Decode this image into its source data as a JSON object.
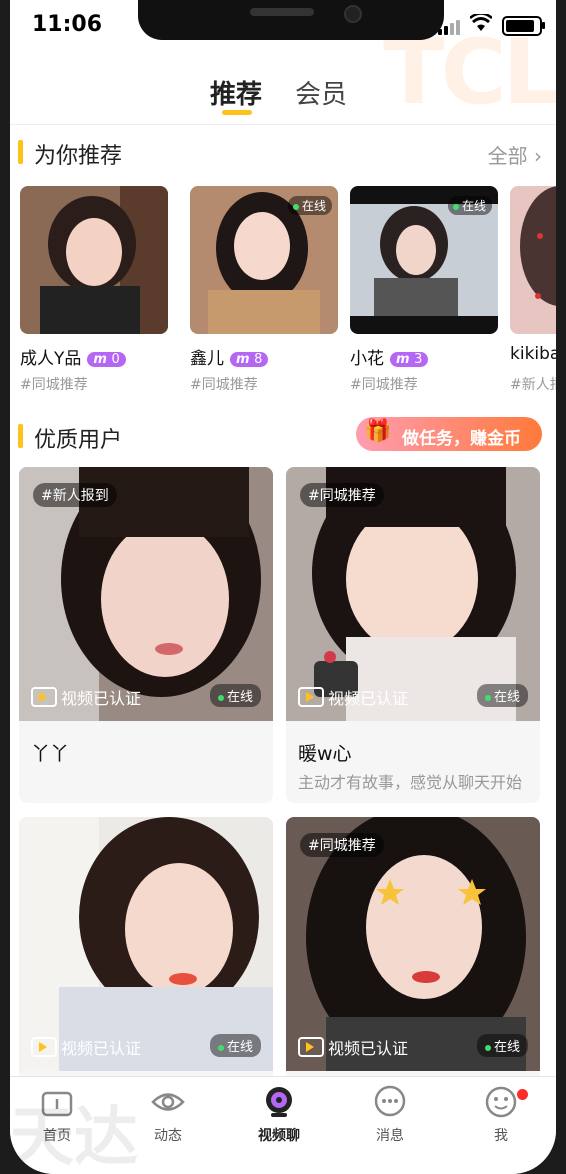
{
  "status": {
    "time": "11:06"
  },
  "tabs": [
    {
      "label": "推荐",
      "active": true
    },
    {
      "label": "会员",
      "active": false
    }
  ],
  "watermark": "TCL",
  "watermark2": "天达",
  "recommend": {
    "title": "为你推荐",
    "all_label": "全部",
    "items": [
      {
        "name": "成人Y品",
        "level": "0",
        "tag": "#同城推荐",
        "online": ""
      },
      {
        "name": "鑫儿",
        "level": "8",
        "tag": "#同城推荐",
        "online": "在线"
      },
      {
        "name": "小花",
        "level": "3",
        "tag": "#同城推荐",
        "online": "在线"
      },
      {
        "name": "kikiba",
        "level": "",
        "tag": "#新人报",
        "online": ""
      }
    ]
  },
  "quality": {
    "title": "优质用户",
    "task_button": "做任务，赚金币",
    "cards": [
      {
        "chip": "#新人报到",
        "verified": "视频已认证",
        "online": "在线",
        "name": "丫丫",
        "desc": ""
      },
      {
        "chip": "#同城推荐",
        "verified": "视频已认证",
        "online": "在线",
        "name": "暖w心",
        "desc": "主动才有故事，感觉从聊天开始"
      },
      {
        "chip": "",
        "verified": "视频已认证",
        "online": "在线",
        "name": "",
        "desc": ""
      },
      {
        "chip": "#同城推荐",
        "verified": "视频已认证",
        "online": "在线",
        "name": "",
        "desc": ""
      }
    ]
  },
  "nav": [
    {
      "label": "首页",
      "icon": "home-icon"
    },
    {
      "label": "动态",
      "icon": "eye-icon"
    },
    {
      "label": "视频聊",
      "icon": "video-chat-icon"
    },
    {
      "label": "消息",
      "icon": "message-icon"
    },
    {
      "label": "我",
      "icon": "smile-icon"
    }
  ],
  "colors": {
    "accent": "#ffc21a",
    "badge": "#b566f5",
    "online": "#3ee06a"
  }
}
